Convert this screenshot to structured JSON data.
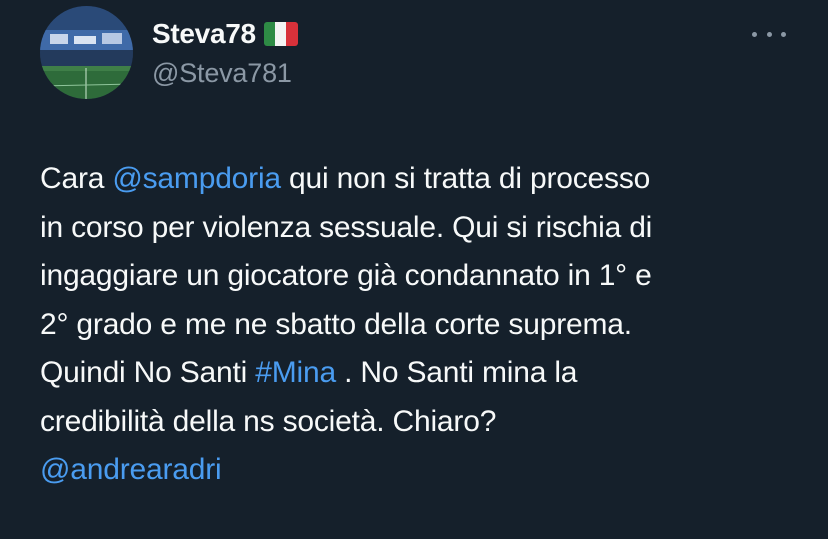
{
  "author": {
    "display_name": "Steva78",
    "handle": "@Steva781",
    "flag_icon": "italy-flag-icon"
  },
  "colors": {
    "background": "#15202b",
    "text": "#f7f9f9",
    "secondary_text": "#8b98a5",
    "link": "#4a9cf0"
  },
  "tweet": {
    "line1": {
      "a": "Cara ",
      "mention": "@sampdoria",
      "b": " qui non si tratta di processo"
    },
    "line2": "in corso per violenza sessuale. Qui si rischia di",
    "line3": "ingaggiare un giocatore già condannato in 1° e",
    "line4": "2° grado e me ne sbatto della corte suprema.",
    "line5": {
      "a": "Quindi No Santi ",
      "hashtag": "#Mina",
      "b": " . No Santi mina la"
    },
    "line6": "credibilità della ns società. Chiaro?",
    "line7": {
      "mention": "@andrearadri"
    }
  }
}
